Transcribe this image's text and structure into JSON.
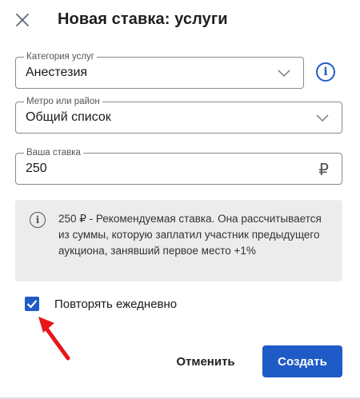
{
  "dialog": {
    "title": "Новая ставка: услуги",
    "close_icon": "close-icon"
  },
  "fields": {
    "category": {
      "label": "Категория услуг",
      "value": "Анестезия"
    },
    "metro": {
      "label": "Метро или район",
      "value": "Общий список"
    },
    "bid": {
      "label": "Ваша ставка",
      "value": "250",
      "currency": "₽"
    }
  },
  "info": {
    "text": "250 ₽ - Рекомендуемая ставка. Она рассчитывается из суммы, которую заплатил участник предыдущего аукциона, занявший первое место +1%"
  },
  "repeat": {
    "label": "Повторять ежедневно",
    "checked": true
  },
  "actions": {
    "cancel": "Отменить",
    "create": "Создать"
  },
  "colors": {
    "accent": "#1e5bc6",
    "arrow": "#e8161b",
    "info_bg": "#ececec"
  }
}
